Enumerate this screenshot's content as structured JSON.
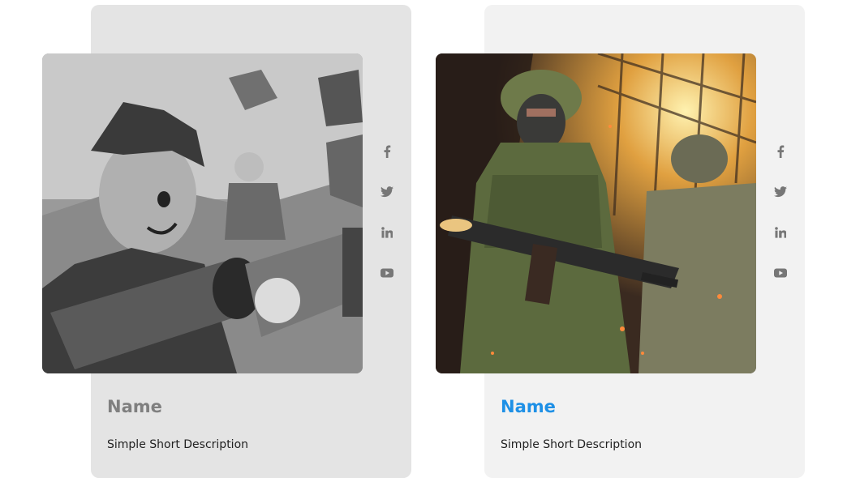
{
  "cards": [
    {
      "name": "Name",
      "description": "Simple Short Description",
      "image_icon": "cartoon-hero-with-bazooka-image",
      "name_color": "#7f7f7f",
      "grayscale": true,
      "social": [
        {
          "icon": "facebook-icon"
        },
        {
          "icon": "twitter-icon"
        },
        {
          "icon": "linkedin-icon"
        },
        {
          "icon": "youtube-icon"
        }
      ]
    },
    {
      "name": "Name",
      "description": "Simple Short Description",
      "image_icon": "soldiers-with-rifles-image",
      "name_color": "#1e90e6",
      "grayscale": false,
      "social": [
        {
          "icon": "facebook-icon"
        },
        {
          "icon": "twitter-icon"
        },
        {
          "icon": "linkedin-icon"
        },
        {
          "icon": "youtube-icon"
        }
      ]
    }
  ],
  "colors": {
    "card1_bg": "#e4e4e4",
    "card2_bg": "#f2f2f2",
    "social_icon": "#777777",
    "accent": "#1e90e6"
  }
}
